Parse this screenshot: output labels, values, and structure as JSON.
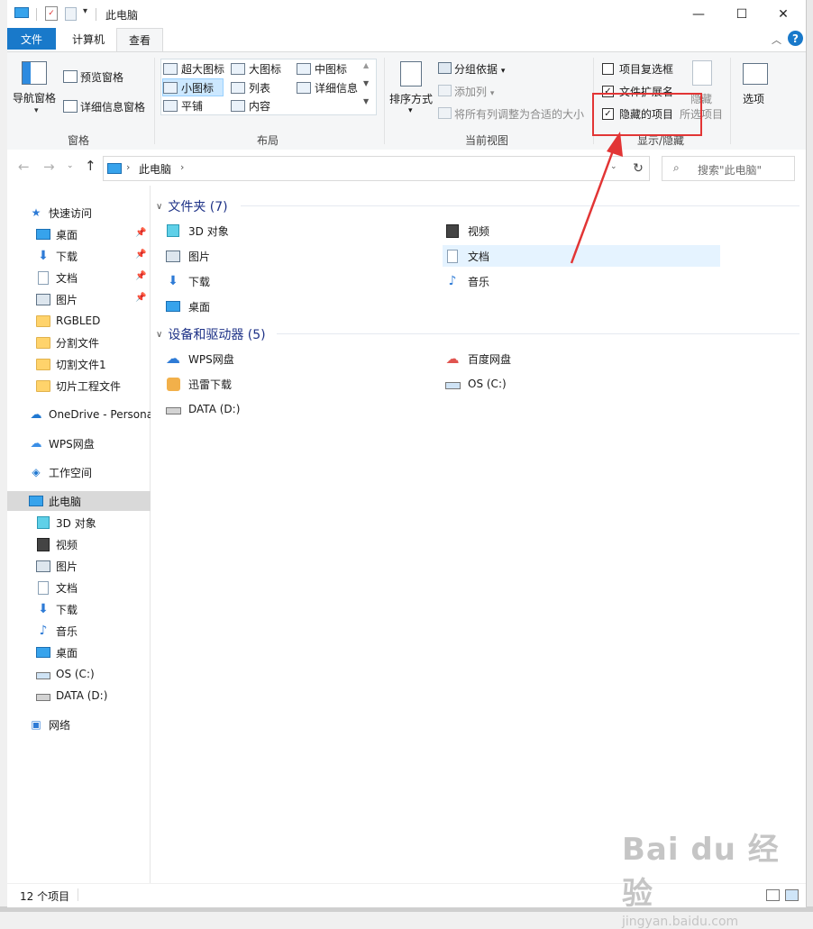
{
  "window": {
    "title": "此电脑",
    "controls": {
      "minimize": "—",
      "maximize": "☐",
      "close": "✕"
    }
  },
  "ribbon_tabs": {
    "file": "文件",
    "computer": "计算机",
    "view": "查看"
  },
  "ribbon": {
    "panes": {
      "navigation_pane": "导航窗格",
      "preview_pane": "预览窗格",
      "details_pane": "详细信息窗格",
      "group_label": "窗格"
    },
    "layout": {
      "extra_large_icons": "超大图标",
      "large_icons": "大图标",
      "medium_icons": "中图标",
      "small_icons": "小图标",
      "list": "列表",
      "details": "详细信息",
      "tiles": "平铺",
      "content": "内容",
      "group_label": "布局",
      "selected": "小图标"
    },
    "current_view": {
      "sort_by": "排序方式",
      "group_by": "分组依据",
      "add_columns": "添加列",
      "size_all_columns": "将所有列调整为合适的大小",
      "group_label": "当前视图"
    },
    "show_hide": {
      "item_checkboxes": "项目复选框",
      "item_checkboxes_checked": false,
      "file_name_extensions": "文件扩展名",
      "file_name_extensions_checked": true,
      "hidden_items": "隐藏的项目",
      "hidden_items_checked": true,
      "hide_selected_line1": "隐藏",
      "hide_selected_line2": "所选项目",
      "group_label": "显示/隐藏"
    },
    "options": "选项"
  },
  "address": {
    "path": "此电脑",
    "search_placeholder": "搜索\"此电脑\""
  },
  "nav_pane": {
    "quick_access": "快速访问",
    "quick_items": [
      {
        "label": "桌面",
        "icon": "desktop-icon",
        "pinned": true
      },
      {
        "label": "下载",
        "icon": "download-icon",
        "pinned": true
      },
      {
        "label": "文档",
        "icon": "document-icon",
        "pinned": true
      },
      {
        "label": "图片",
        "icon": "pictures-icon",
        "pinned": true
      },
      {
        "label": "RGBLED",
        "icon": "folder-icon",
        "pinned": false
      },
      {
        "label": "分割文件",
        "icon": "folder-icon",
        "pinned": false
      },
      {
        "label": "切割文件1",
        "icon": "folder-icon",
        "pinned": false
      },
      {
        "label": "切片工程文件",
        "icon": "folder-icon",
        "pinned": false
      }
    ],
    "onedrive": "OneDrive - Persona",
    "wps": "WPS网盘",
    "workspace": "工作空间",
    "this_pc": "此电脑",
    "pc_items": [
      {
        "label": "3D 对象",
        "icon": "3d-objects-icon"
      },
      {
        "label": "视频",
        "icon": "videos-icon"
      },
      {
        "label": "图片",
        "icon": "pictures-icon"
      },
      {
        "label": "文档",
        "icon": "document-icon"
      },
      {
        "label": "下载",
        "icon": "download-icon"
      },
      {
        "label": "音乐",
        "icon": "music-icon"
      },
      {
        "label": "桌面",
        "icon": "desktop-icon"
      },
      {
        "label": "OS (C:)",
        "icon": "os-drive-icon"
      },
      {
        "label": "DATA (D:)",
        "icon": "drive-icon"
      }
    ],
    "network": "网络"
  },
  "content": {
    "folders_header": "文件夹 (7)",
    "folders": [
      {
        "label": "3D 对象",
        "icon": "3d-objects-icon"
      },
      {
        "label": "视频",
        "icon": "videos-icon"
      },
      {
        "label": "图片",
        "icon": "pictures-icon"
      },
      {
        "label": "文档",
        "icon": "document-icon"
      },
      {
        "label": "下载",
        "icon": "download-icon"
      },
      {
        "label": "音乐",
        "icon": "music-icon"
      },
      {
        "label": "桌面",
        "icon": "desktop-icon"
      }
    ],
    "devices_header": "设备和驱动器 (5)",
    "devices": [
      {
        "label": "WPS网盘",
        "icon": "wps-cloud-icon"
      },
      {
        "label": "百度网盘",
        "icon": "baidu-netdisk-icon"
      },
      {
        "label": "迅雷下载",
        "icon": "xunlei-icon"
      },
      {
        "label": "OS (C:)",
        "icon": "os-drive-icon"
      },
      {
        "label": "DATA (D:)",
        "icon": "drive-icon"
      }
    ]
  },
  "status": {
    "item_count": "12 个项目"
  },
  "watermark": {
    "logo": "Bai du 经验",
    "url": "jingyan.baidu.com"
  },
  "colors": {
    "accent": "#1979ca",
    "annotation": "#e23535",
    "group_header": "#1e3287"
  }
}
